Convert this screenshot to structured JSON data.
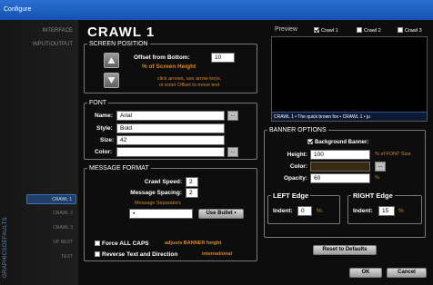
{
  "window": {
    "title": "Configure"
  },
  "nav": {
    "top_items": [
      {
        "label": "INTERFACE"
      },
      {
        "label": "INPUT/OUTPUT"
      }
    ],
    "vertical_tabs": [
      {
        "label": "GRAPHICS"
      },
      {
        "label": "DEFAULTS"
      }
    ],
    "sub_items": [
      {
        "label": "CRAWL 1",
        "active": true
      },
      {
        "label": "CRAWL 2",
        "active": false
      },
      {
        "label": "CRAWL 3",
        "active": false
      },
      {
        "label": "UP NEXT",
        "active": false
      },
      {
        "label": "TEXT",
        "active": false
      }
    ]
  },
  "page_title": "CRAWL 1",
  "screen_position": {
    "legend": "SCREEN POSITION",
    "offset_label": "Offset from Bottom:",
    "offset_value": "10",
    "offset_unit": "% of Screen Height",
    "hint": "click arrows, use arrow keys,\nor enter Offset to move text"
  },
  "font": {
    "legend": "FONT",
    "name_label": "Name:",
    "name_value": "Arial",
    "style_label": "Style:",
    "style_value": "Bold",
    "size_label": "Size:",
    "size_value": "42",
    "color_label": "Color:",
    "color_value": "",
    "ellipsis": "..."
  },
  "message_format": {
    "legend": "MESSAGE FORMAT",
    "speed_label": "Crawl Speed:",
    "speed_value": "2",
    "spacing_label": "Message Spacing:",
    "spacing_value": "2",
    "separators_label": "Message Separators",
    "separator_value": "•",
    "use_bullet_button": "Use Bullet •",
    "force_caps_label": "Force ALL CAPS",
    "force_caps_note": "adjusts BANNER height",
    "reverse_label": "Reverse Text and Direction",
    "reverse_note": "international"
  },
  "preview": {
    "label": "Preview",
    "checkboxes": [
      {
        "label": "Crawl 1",
        "checked": true
      },
      {
        "label": "Crawl 2",
        "checked": false
      },
      {
        "label": "Crawl 3",
        "checked": false
      }
    ],
    "crawl_text": "CRAWL 1  •  The quick brown fox  •  CRAWL 1  •  ju"
  },
  "banner_options": {
    "legend": "BANNER OPTIONS",
    "background_label": "Background Banner:",
    "background_checked": true,
    "height_label": "Height:",
    "height_value": "100",
    "height_unit": "% of FONT Size",
    "color_label": "Color:",
    "color_value": "#3a2a12",
    "opacity_label": "Opacity:",
    "opacity_value": "60",
    "opacity_unit": "%",
    "ellipsis": "..."
  },
  "left_edge": {
    "legend": "LEFT Edge",
    "indent_label": "Indent:",
    "indent_value": "0",
    "unit": "%"
  },
  "right_edge": {
    "legend": "RIGHT Edge",
    "indent_label": "Indent:",
    "indent_value": "15",
    "unit": "%"
  },
  "buttons": {
    "reset": "Reset to Defaults",
    "ok": "OK",
    "cancel": "Cancel"
  },
  "colors": {
    "accent_gold": "#d48a2a",
    "title_bar": "#1d5fc4",
    "banner_color": "#3a2a12"
  }
}
